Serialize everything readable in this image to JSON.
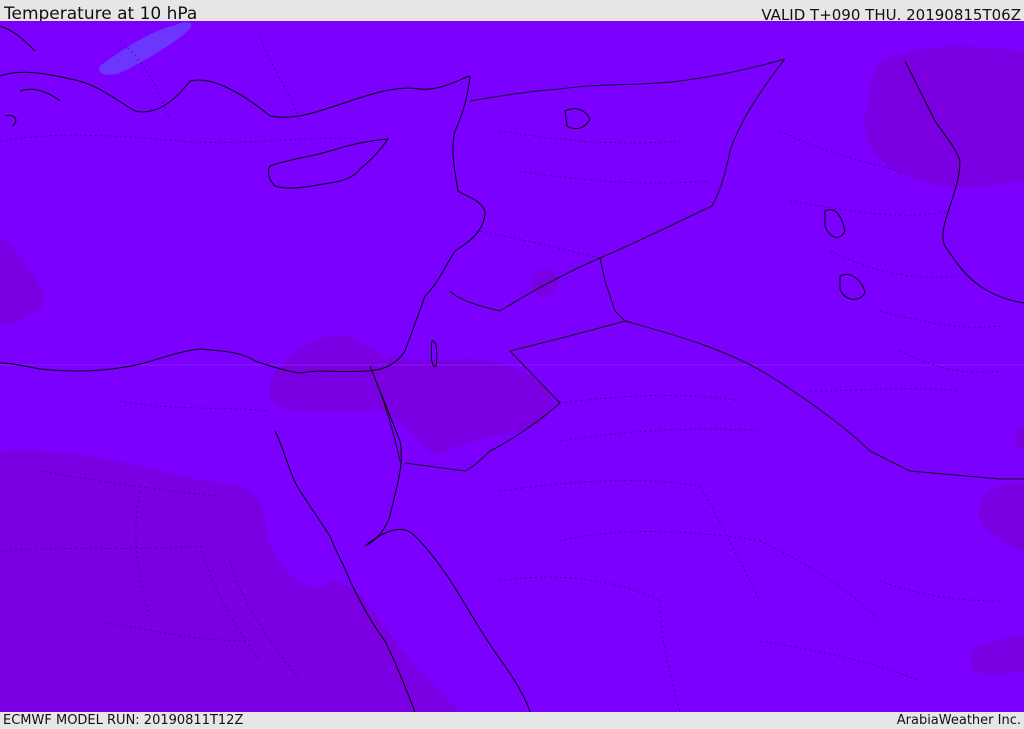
{
  "header": {
    "title": "Temperature at 10 hPa",
    "valid_time": "VALID T+090 THU. 20190815T06Z"
  },
  "footer": {
    "model_run": "ECMWF MODEL RUN: 20190811T12Z",
    "provider": "ArabiaWeather Inc."
  },
  "map": {
    "field": "Temperature at 10 hPa",
    "colors": {
      "base_fill": "#7b00ff",
      "warm_patch": "#7a00e0",
      "cool_patch": "#6a3cff",
      "coastline": "#000000",
      "border": "#333333"
    }
  }
}
